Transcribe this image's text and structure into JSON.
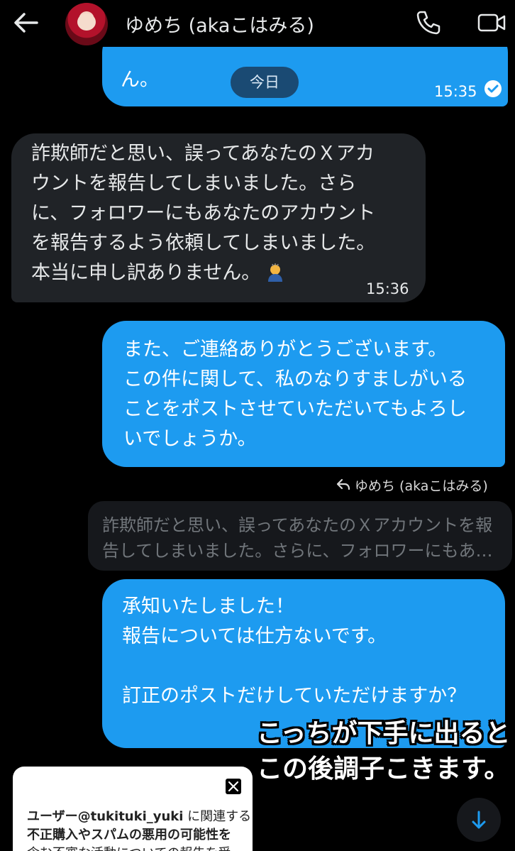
{
  "header": {
    "title": "ゆめち (akaこはみる)",
    "back_icon": "arrow-left-icon",
    "phone_icon": "phone-icon",
    "video_icon": "video-camera-icon"
  },
  "messages": {
    "first_partial": {
      "text_tail": "ん。",
      "time": "15:35"
    },
    "date_divider": "今日",
    "received": {
      "lines": [
        "詐欺師だと思い、誤ってあなたのＸアカ",
        "ウントを報告してしまいました。さら",
        "に、フォロワーにもあなたのアカウント",
        "を報告するよう依頼してしまいました。",
        "本当に申し訳ありません。"
      ],
      "emoji": "bowing-person-emoji",
      "time": "15:36"
    },
    "sent_1": {
      "lines": [
        "また、ご連絡ありがとうございます。",
        "この件に関して、私のなりすましがいる",
        "ことをポストさせていただいてもよろし",
        "いでしょうか。"
      ]
    },
    "reply": {
      "label": "ゆめち (akaこはみる)",
      "quoted_lines": [
        "詐欺師だと思い、誤ってあなたのＸアカウントを報",
        "告してしまいました。さらに、フォロワーにもあ…"
      ]
    },
    "sent_2": {
      "lines": [
        "承知いたしました！",
        "報告については仕方ないです。",
        "",
        "訂正のポストだけしていただけますか？"
      ]
    }
  },
  "caption": {
    "line1": "こっちが下手に出ると",
    "line2": "この後調子こきます。"
  },
  "card": {
    "line1_a": "ユーザー@tukituki_yuki",
    "line1_b": " に関連する",
    "line2": "不正購入やスパムの悪用の可能性を",
    "line3": "含む不審な活動についての報告を受"
  },
  "scroll_button_icon": "arrow-down-icon",
  "colors": {
    "background": "#000000",
    "sent_bubble": "#1d9bf0",
    "received_bubble": "#202327",
    "quoted_bubble": "#16181c"
  }
}
